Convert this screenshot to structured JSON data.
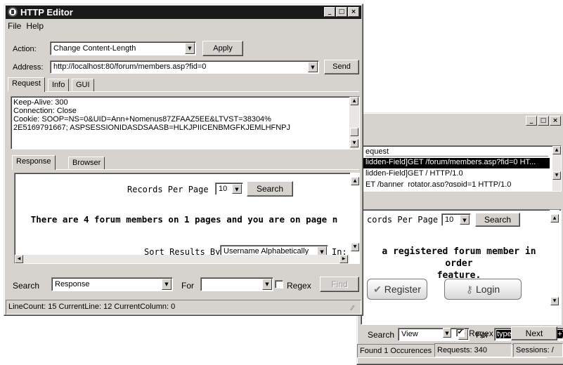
{
  "colors": {
    "titlebar": "#1a1a1a",
    "chrome": "#d6d3ce",
    "selection": "#000000"
  },
  "back_window": {
    "window_buttons": [
      "_",
      "□",
      "×"
    ],
    "list_header": "equest",
    "list_items": [
      "lidden-Field]GET /forum/members.asp?fid=0 HT...",
      "lidden-Field]GET / HTTP/1.0",
      "ET /banner_rotator.asp?gspid=1 HTTP/1.0"
    ],
    "records_per_page_label": "cords Per Page",
    "records_per_page_value": "10",
    "search_label": "Search",
    "message": "a registered forum member in order\nfeature.",
    "register_label": "Register",
    "login_label": "Login",
    "search_bar": {
      "search_label": "Search",
      "search_value": "View",
      "for_label": "For",
      "for_value": "type(?:\\s+)?=(?:\\s+)?.?hidden",
      "regex_label": "Regex",
      "regex_checked": "✔",
      "next_label": "Next"
    },
    "status": {
      "found": "Found 1 Occurences",
      "requests": "Requests: 340",
      "sessions": "Sessions: /"
    }
  },
  "front_window": {
    "title": "HTTP Editor",
    "window_buttons": [
      "_",
      "□",
      "×"
    ],
    "menu": [
      "File",
      "Help"
    ],
    "action_label": "Action:",
    "action_value": "Change Content-Length",
    "apply_label": "Apply",
    "address_label": "Address:",
    "address_value": "http://localhost:80/forum/members.asp?fid=0",
    "send_label": "Send",
    "tabs": [
      "Request",
      "Info",
      "GUI"
    ],
    "request_text": "Keep-Alive: 300\nConnection: Close\nCookie: SOOP=NS=0&UID=Ann+Nomenus87ZFAAZ5EE&LTVST=38304%\n2E5169791667; ASPSESSIONIDASDSAASB=HLKJPIICENBMGFKJEMLHFNPJ",
    "response_tabs": [
      "Response",
      "Browser"
    ],
    "records_per_page_label": "Records Per Page",
    "records_per_page_value": "10",
    "search_button": "Search",
    "members_message": "There are 4 forum members on 1 pages and you are on page n",
    "sort_label": "Sort Results By",
    "sort_value": "Username Alphabetically",
    "in_label": "In:",
    "search_bar": {
      "search_label": "Search",
      "search_value": "Response",
      "for_label": "For",
      "for_value": "",
      "regex_label": "Regex",
      "find_label": "Find"
    },
    "status": "LineCount: 15 CurrentLine: 12 CurrentColumn: 0"
  }
}
